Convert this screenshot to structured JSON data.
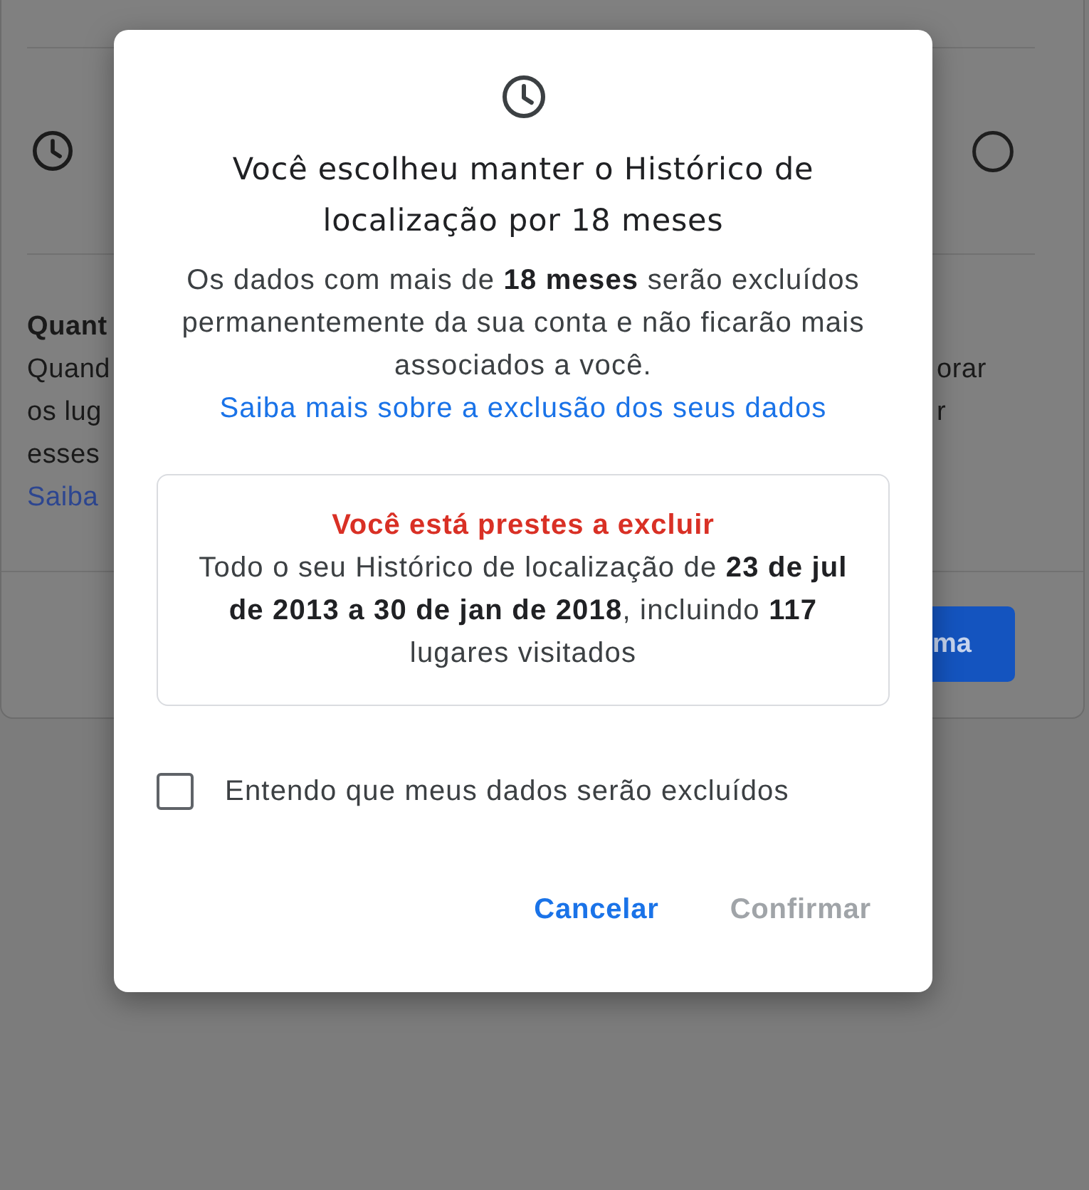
{
  "background_page": {
    "left_column": {
      "heading": "Quant",
      "lines": [
        "Quand",
        "os lug",
        "esses"
      ],
      "link": "Saiba"
    },
    "right_column": {
      "lines": [
        "orar",
        "r"
      ]
    },
    "radio": {
      "selected": false
    },
    "button": {
      "label": "ma"
    }
  },
  "dialog": {
    "title": "Você escolheu manter o Histórico de localização por 18 meses",
    "body": "Os dados com mais de **18 meses** serão excluídos permanentemente da sua conta e não ficarão mais associados a você.",
    "body_link": "Saiba mais sobre a exclusão dos seus dados",
    "warning": {
      "title": "Você está prestes a excluir",
      "text": "Todo o seu Histórico de localização de **23 de jul de 2013 a 30 de jan de 2018**, incluindo **117** lugares visitados"
    },
    "checkbox": {
      "label": "Entendo que meus dados serão excluídos",
      "checked": false
    },
    "buttons": [
      {
        "label": "Cancelar",
        "disabled": false
      },
      {
        "label": "Confirmar",
        "disabled": true
      }
    ]
  }
}
